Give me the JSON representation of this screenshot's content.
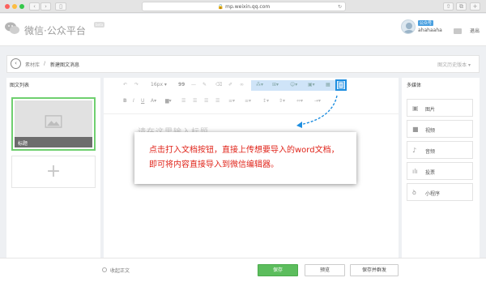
{
  "browser": {
    "url": "mp.weixin.qq.com"
  },
  "header": {
    "logo_text": "微信·公众平台",
    "beta": "beta",
    "user_tag": "公众号",
    "username": "ahahaaha",
    "logout": "退出"
  },
  "breadcrumb": {
    "root": "素材库",
    "sep": "/",
    "current": "新建图文消息",
    "history": "图文历史版本"
  },
  "left": {
    "title": "图文列表",
    "card_title": "标题",
    "add": "+"
  },
  "editor": {
    "title_placeholder": "请在这里输入标题",
    "font_size": "16px",
    "quote": "99"
  },
  "right": {
    "title": "多媒体",
    "items": [
      {
        "label": "图片",
        "icon": "image-icon"
      },
      {
        "label": "视频",
        "icon": "video-icon"
      },
      {
        "label": "音频",
        "icon": "audio-icon"
      },
      {
        "label": "投票",
        "icon": "vote-icon"
      },
      {
        "label": "小程序",
        "icon": "mini-program-icon"
      }
    ]
  },
  "bottom": {
    "collapse": "收起正文",
    "save": "保存",
    "preview": "预览",
    "publish": "保存并群发"
  },
  "callout": {
    "text": "点击打入文档按钮，直接上传想要导入的word文档，即可将内容直接导入到微信编辑器。"
  },
  "colors": {
    "accent_green": "#5cbd5d",
    "callout_red": "#e0241a",
    "highlight_blue": "#1e8ee0"
  }
}
